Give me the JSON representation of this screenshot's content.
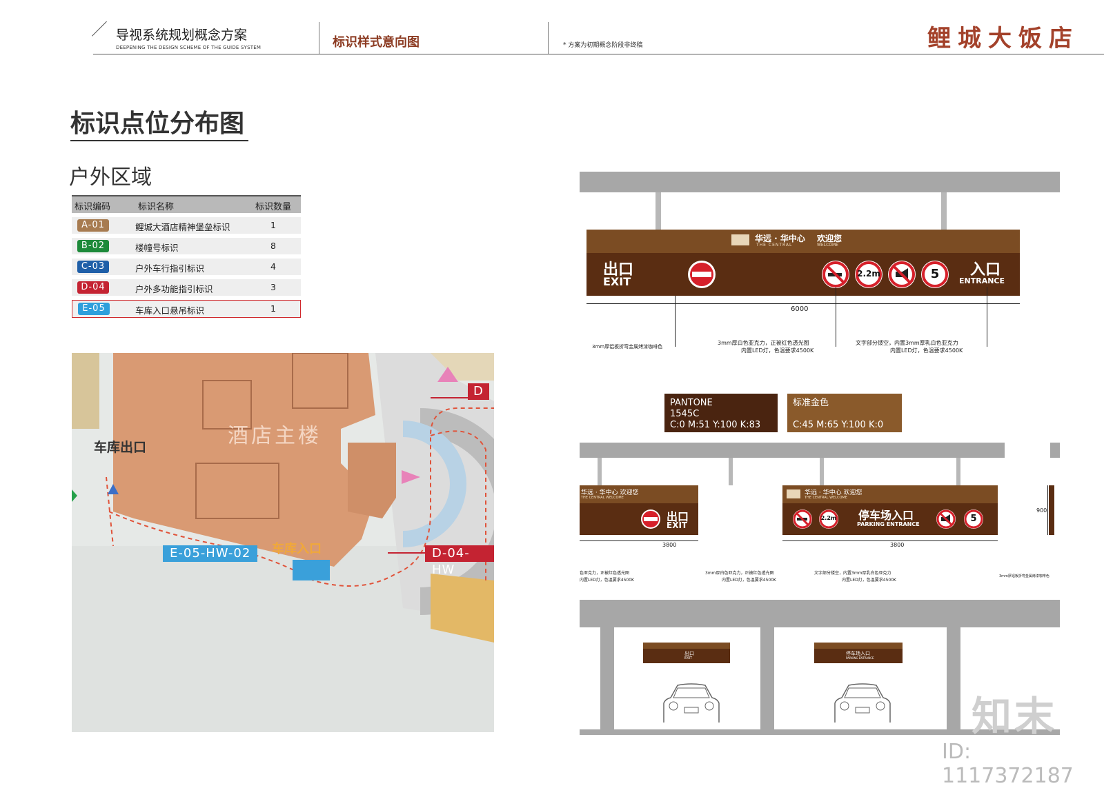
{
  "header": {
    "title": "导视系统规划概念方案",
    "subtitle": "DEEPENING THE DESIGN SCHEME OF THE GUIDE SYSTEM",
    "section": "标识样式意向图",
    "note": "* 方案为初期概念阶段非终稿",
    "brand": "鲤城大饭店"
  },
  "page": {
    "title": "标识点位分布图",
    "subtitle": "户外区域"
  },
  "table": {
    "headers": [
      "标识编码",
      "标识名称",
      "标识数量"
    ],
    "rows": [
      {
        "code": "A-01",
        "name": "鲤城大酒店精神堡垒标识",
        "count": "1",
        "color": "#a77b50"
      },
      {
        "code": "B-02",
        "name": "楼幢号标识",
        "count": "8",
        "color": "#1d8a3a"
      },
      {
        "code": "C-03",
        "name": "户外车行指引标识",
        "count": "4",
        "color": "#1f5fa8"
      },
      {
        "code": "D-04",
        "name": "户外多功能指引标识",
        "count": "3",
        "color": "#c42332"
      },
      {
        "code": "E-05",
        "name": "车库入口悬吊标识",
        "count": "1",
        "color": "#2e9fdc"
      }
    ]
  },
  "map": {
    "building_label": "酒店主楼",
    "garage_exit": "车库出口",
    "garage_entrance": "车库入口",
    "tag_e05": "E-05-HW-02",
    "tag_d04": "D-04-HW",
    "tag_d": "D"
  },
  "sign_large": {
    "brand_cn": "华远 · 华中心",
    "brand_en": "THE CENTRAL",
    "welcome_cn": "欢迎您",
    "welcome_en": "WELCOME",
    "exit_cn": "出口",
    "exit_en": "EXIT",
    "entrance_cn": "入口",
    "entrance_en": "ENTRANCE",
    "height_sign": "2.2m",
    "speed_sign": "5",
    "width_dim": "6000",
    "note_left": "3mm厚铝板折弯金属烤漆咖啡色",
    "note_mid_1": "3mm厚白色亚克力，正被红色透光图",
    "note_mid_2": "内置LED灯，色温要求4500K",
    "note_right_1": "文字部分镂空，内置3mm厚乳白色亚克力",
    "note_right_2": "内置LED灯，色温要求4500K"
  },
  "pantone": {
    "left_1": "PANTONE",
    "left_2": "1545C",
    "left_3": "C:0  M:51  Y:100  K:83",
    "left_color": "#4a2410",
    "right_1": "标准金色",
    "right_2": "C:45  M:65  Y:100  K:0",
    "right_color": "#8a5a2b"
  },
  "sign_small": {
    "brand_cn": "华远 · 华中心  欢迎您",
    "brand_en": "THE CENTRAL   WELCOME",
    "exit_cn": "出口",
    "exit_en": "EXIT",
    "parking_cn": "停车场入口",
    "parking_en": "PARKING ENTRANCE",
    "height_sign": "2.2m",
    "speed_sign": "5",
    "dim_left": "3800",
    "dim_right": "3800",
    "dim_height": "900",
    "note_a_1": "色亚克力，正被红色透光图",
    "note_a_2": "内置LED灯，色温要求4500K",
    "note_b_1": "3mm厚白色亚克力，正被红色透光图",
    "note_b_2": "内置LED灯，色温要求4500K",
    "note_c_1": "文字部分镂空，内置3mm厚乳白色亚克力",
    "note_c_2": "内置LED灯，色温要求4500K",
    "note_d": "3mm厚铝板折弯金属烤漆咖啡色"
  },
  "garage": {
    "exit_cn": "出口",
    "exit_en": "EXIT",
    "parking_cn": "停车场入口",
    "parking_en": "PARKING ENTRANCE"
  },
  "watermark": {
    "logo": "知末",
    "id": "ID: 1117372187"
  }
}
